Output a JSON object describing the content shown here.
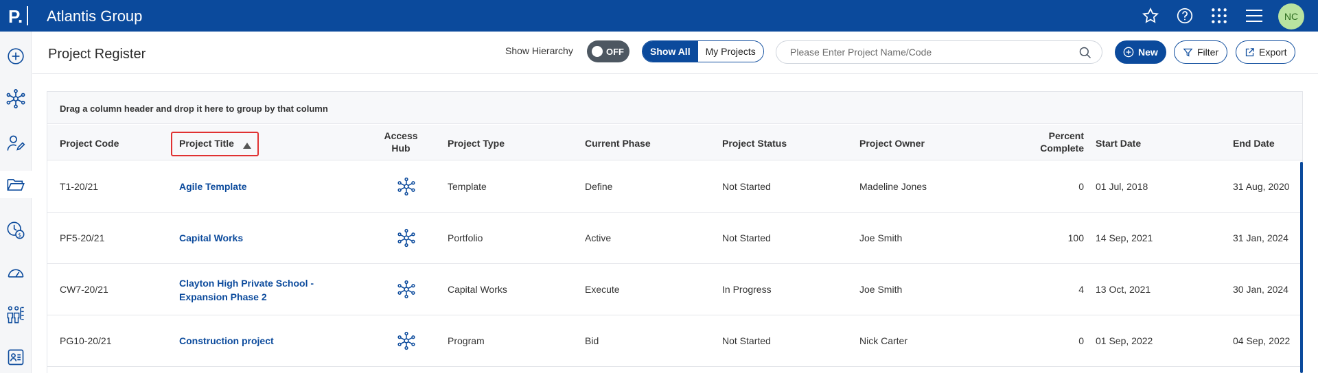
{
  "app": {
    "logo": "P.",
    "title": "Atlantis Group",
    "avatar": "NC"
  },
  "header": {
    "title": "Project Register",
    "hierarchy_label": "Show Hierarchy",
    "toggle_state": "OFF",
    "segment": {
      "all": "Show All",
      "mine": "My Projects"
    },
    "search_placeholder": "Please Enter Project Name/Code",
    "new_label": "New",
    "filter_label": "Filter",
    "export_label": "Export"
  },
  "grid": {
    "group_hint": "Drag a column header and drop it here to group by that column",
    "columns": {
      "code": "Project Code",
      "title": "Project Title",
      "hub": "Access Hub",
      "type": "Project Type",
      "phase": "Current Phase",
      "status": "Project Status",
      "owner": "Project Owner",
      "percent": "Percent Complete",
      "start": "Start Date",
      "end": "End Date"
    },
    "sort": {
      "column": "Project Title",
      "direction": "ascending"
    },
    "rows": [
      {
        "code": "T1-20/21",
        "title": "Agile Template",
        "type": "Template",
        "phase": "Define",
        "status": "Not Started",
        "owner": "Madeline Jones",
        "percent": "0",
        "start": "01 Jul, 2018",
        "end": "31 Aug, 2020"
      },
      {
        "code": "PF5-20/21",
        "title": "Capital Works",
        "type": "Portfolio",
        "phase": "Active",
        "status": "Not Started",
        "owner": "Joe Smith",
        "percent": "100",
        "start": "14 Sep, 2021",
        "end": "31 Jan, 2024"
      },
      {
        "code": "CW7-20/21",
        "title": "Clayton High Private School - Expansion Phase 2",
        "type": "Capital Works",
        "phase": "Execute",
        "status": "In Progress",
        "owner": "Joe Smith",
        "percent": "4",
        "start": "13 Oct, 2021",
        "end": "30 Jan, 2024"
      },
      {
        "code": "PG10-20/21",
        "title": "Construction project",
        "type": "Program",
        "phase": "Bid",
        "status": "Not Started",
        "owner": "Nick Carter",
        "percent": "0",
        "start": "01 Sep, 2022",
        "end": "04 Sep, 2022"
      }
    ]
  },
  "icons": {
    "top": [
      "star-icon",
      "help-icon",
      "apps-grid-icon",
      "menu-icon"
    ],
    "sidebar": [
      "add-icon",
      "hub-network-icon",
      "user-edit-icon",
      "folder-open-icon",
      "clock-dollar-icon",
      "dashboard-gauge-icon",
      "org-people-icon",
      "contact-card-icon"
    ]
  },
  "colors": {
    "brand": "#0b4a9c",
    "highlight": "#e03131",
    "avatar_bg": "#b9e3a0"
  }
}
